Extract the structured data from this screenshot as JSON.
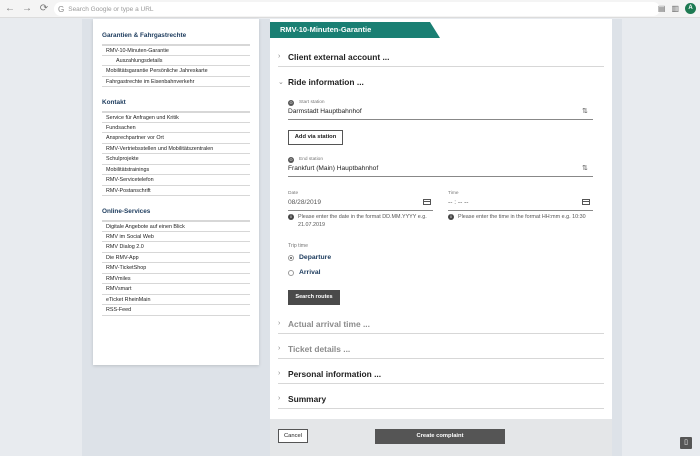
{
  "browser": {
    "back_icon": "←",
    "forward_icon": "→",
    "reload_icon": "⟳",
    "omnibox_placeholder": "Search Google or type a URL",
    "avatar_letter": "A"
  },
  "sidebar": {
    "sections": [
      {
        "title": "Garantien & Fahrgastrechte",
        "items": [
          "RMV-10-Minuten-Garantie",
          "Auszahlungsdetails",
          "Mobilitätsgarantie Persönliche Jahreskarte",
          "Fahrgastrechte im Eisenbahnverkehr"
        ]
      },
      {
        "title": "Kontakt",
        "items": [
          "Service für Anfragen und Kritik",
          "Fundsachen",
          "Ansprechpartner vor Ort",
          "RMV-Vertriebsstellen und Mobilitätszentralen",
          "Schulprojekte",
          "Mobilitätstrainings",
          "RMV-Servicetelefon",
          "RMV-Postanschrift"
        ]
      },
      {
        "title": "Online-Services",
        "items": [
          "Digitale Angebote auf einen Blick",
          "RMV im Social Web",
          "RMV Dialog 2.0",
          "Die RMV-App",
          "RMV-TicketShop",
          "RMVmiles",
          "RMVsmart",
          "eTicket RheinMain",
          "RSS-Feed"
        ]
      }
    ]
  },
  "main": {
    "tab_title": "RMV-10-Minuten-Garantie",
    "client_account": "Client external account ...",
    "ride_information": "Ride information ...",
    "start_station_label": "Start station",
    "start_station_value": "Darmstadt Hauptbahnhof",
    "add_via_station": "Add via station",
    "end_station_label": "End station",
    "end_station_value": "Frankfurt (Main) Hauptbahnhof",
    "date_label": "Date",
    "date_value": "08/28/2019",
    "date_hint": "Please enter the date in the format DD.MM.YYYY e.g. 21.07.2019",
    "time_label": "Time",
    "time_value": "-- : -- --",
    "time_hint": "Please enter the time in the format HH:mm e.g. 10:30",
    "trip_time_label": "Trip time",
    "departure": "Departure",
    "arrival": "Arrival",
    "search_routes": "Search routes",
    "actual_arrival_time": "Actual arrival time ...",
    "ticket_details": "Ticket details ...",
    "personal_information": "Personal information ...",
    "summary": "Summary",
    "cancel": "Cancel",
    "create_complaint": "Create complaint"
  }
}
